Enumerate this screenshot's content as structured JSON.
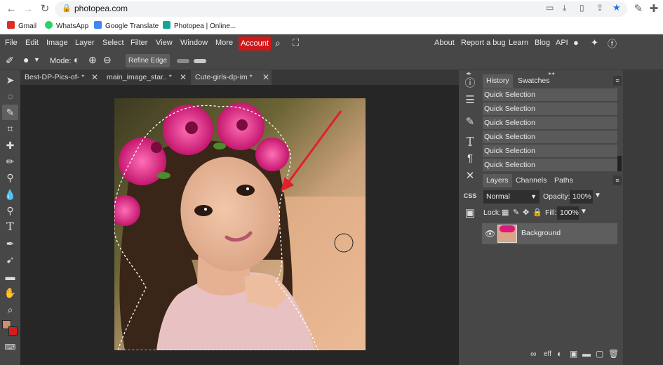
{
  "browser": {
    "url": "photopea.com",
    "bookmarks": [
      {
        "label": "Gmail",
        "color": "#d93025"
      },
      {
        "label": "WhatsApp",
        "color": "#25d366"
      },
      {
        "label": "Google Translate",
        "color": "#4285f4"
      },
      {
        "label": "Photopea | Online...",
        "color": "#18a497"
      }
    ]
  },
  "menu": {
    "items": [
      "File",
      "Edit",
      "Image",
      "Layer",
      "Select",
      "Filter",
      "View",
      "Window",
      "More"
    ],
    "account": "Account",
    "right_items": [
      "About",
      "Report a bug",
      "Learn",
      "Blog",
      "API"
    ]
  },
  "options": {
    "mode_label": "Mode:",
    "refine_edge": "Refine Edge"
  },
  "tabs": [
    {
      "label": "Best-DP-Pics-of-",
      "modified": "*"
    },
    {
      "label": "main_image_star..",
      "modified": "*"
    },
    {
      "label": "Cute-girls-dp-im",
      "modified": "*"
    }
  ],
  "history_panel": {
    "tabs": [
      "History",
      "Swatches"
    ],
    "rows": [
      "Quick Selection",
      "Quick Selection",
      "Quick Selection",
      "Quick Selection",
      "Quick Selection",
      "Quick Selection"
    ]
  },
  "layers_panel": {
    "tabs": [
      "Layers",
      "Channels",
      "Paths"
    ],
    "blend_mode": "Normal",
    "opacity_label": "Opacity:",
    "opacity_value": "100%",
    "lock_label": "Lock:",
    "fill_label": "Fill:",
    "fill_value": "100%",
    "layer_name": "Background"
  },
  "mid_column": {
    "css_label": "CSS"
  },
  "colors": {
    "accent_red": "#d11818",
    "foreground_swatch": "#c8926e",
    "background_swatch": "#d81c1c",
    "annotation_arrow": "#e0202a"
  }
}
